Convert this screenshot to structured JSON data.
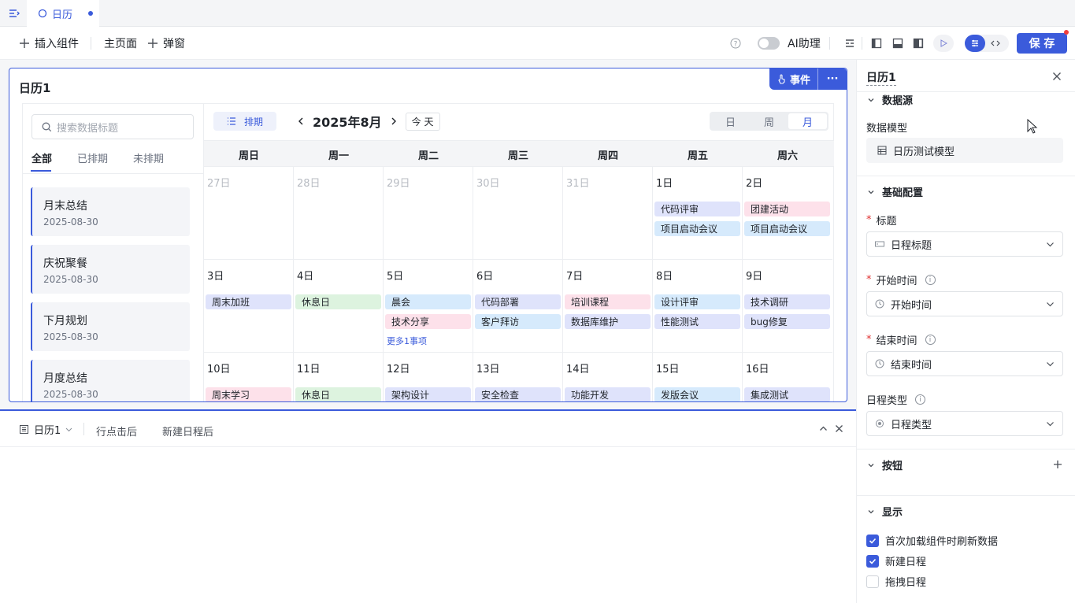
{
  "tabbar": {
    "tab_label": "日历"
  },
  "toolbar": {
    "insert_label": "插入组件",
    "home_label": "主页面",
    "popup_label": "弹窗",
    "ai_label": "AI助理",
    "save_label": "保 存"
  },
  "widget": {
    "title": "日历1",
    "event_label": "事件",
    "search_placeholder": "搜索数据标题",
    "list_tabs": [
      "全部",
      "已排期",
      "未排期"
    ],
    "cards": [
      {
        "title": "月末总结",
        "date": "2025-08-30"
      },
      {
        "title": "庆祝聚餐",
        "date": "2025-08-30"
      },
      {
        "title": "下月规划",
        "date": "2025-08-30"
      },
      {
        "title": "月度总结",
        "date": "2025-08-30"
      }
    ],
    "plan_label": "排期",
    "month_label": "2025年8月",
    "today_label": "今 天",
    "views": [
      "日",
      "周",
      "月"
    ],
    "weekdays": [
      "周日",
      "周一",
      "周二",
      "周三",
      "周四",
      "周五",
      "周六"
    ],
    "more_label": "更多1事项",
    "days": {
      "r0": [
        "27日",
        "28日",
        "29日",
        "30日",
        "31日",
        "1日",
        "2日"
      ],
      "r1": [
        "3日",
        "4日",
        "5日",
        "6日",
        "7日",
        "8日",
        "9日"
      ],
      "r2": [
        "10日",
        "11日",
        "12日",
        "13日",
        "14日",
        "15日",
        "16日"
      ]
    },
    "events": {
      "r0c5a": "代码评审",
      "r0c5b": "项目启动会议",
      "r0c6a": "团建活动",
      "r0c6b": "项目启动会议",
      "r1c0a": "周末加班",
      "r1c1a": "休息日",
      "r1c2a": "晨会",
      "r1c2b": "技术分享",
      "r1c3a": "代码部署",
      "r1c3b": "客户拜访",
      "r1c4a": "培训课程",
      "r1c4b": "数据库维护",
      "r1c5a": "设计评审",
      "r1c5b": "性能测试",
      "r1c6a": "技术调研",
      "r1c6b": "bug修复",
      "r2c0a": "周末学习",
      "r2c1a": "休息日",
      "r2c2a": "架构设计",
      "r2c3a": "安全检查",
      "r2c4a": "功能开发",
      "r2c5a": "发版会议",
      "r2c6a": "集成测试"
    }
  },
  "bottom": {
    "component_label": "日历1",
    "tabs": [
      "行点击后",
      "新建日程后"
    ]
  },
  "panel": {
    "title": "日历1",
    "datasource_section": "数据源",
    "model_label": "数据模型",
    "model_value": "日历测试模型",
    "basic_section": "基础配置",
    "title_label": "标题",
    "title_value": "日程标题",
    "start_label": "开始时间",
    "start_value": "开始时间",
    "end_label": "结束时间",
    "end_value": "结束时间",
    "type_label": "日程类型",
    "type_value": "日程类型",
    "button_section": "按钮",
    "display_section": "显示",
    "checks": [
      {
        "label": "首次加载组件时刷新数据",
        "checked": true
      },
      {
        "label": "新建日程",
        "checked": true
      },
      {
        "label": "拖拽日程",
        "checked": false
      }
    ]
  },
  "colors": {
    "accent": "#3b5bdb",
    "purple": "#dfe3fb",
    "green": "#ddf3df",
    "blue": "#d6eafc",
    "pink": "#fde1ea"
  }
}
